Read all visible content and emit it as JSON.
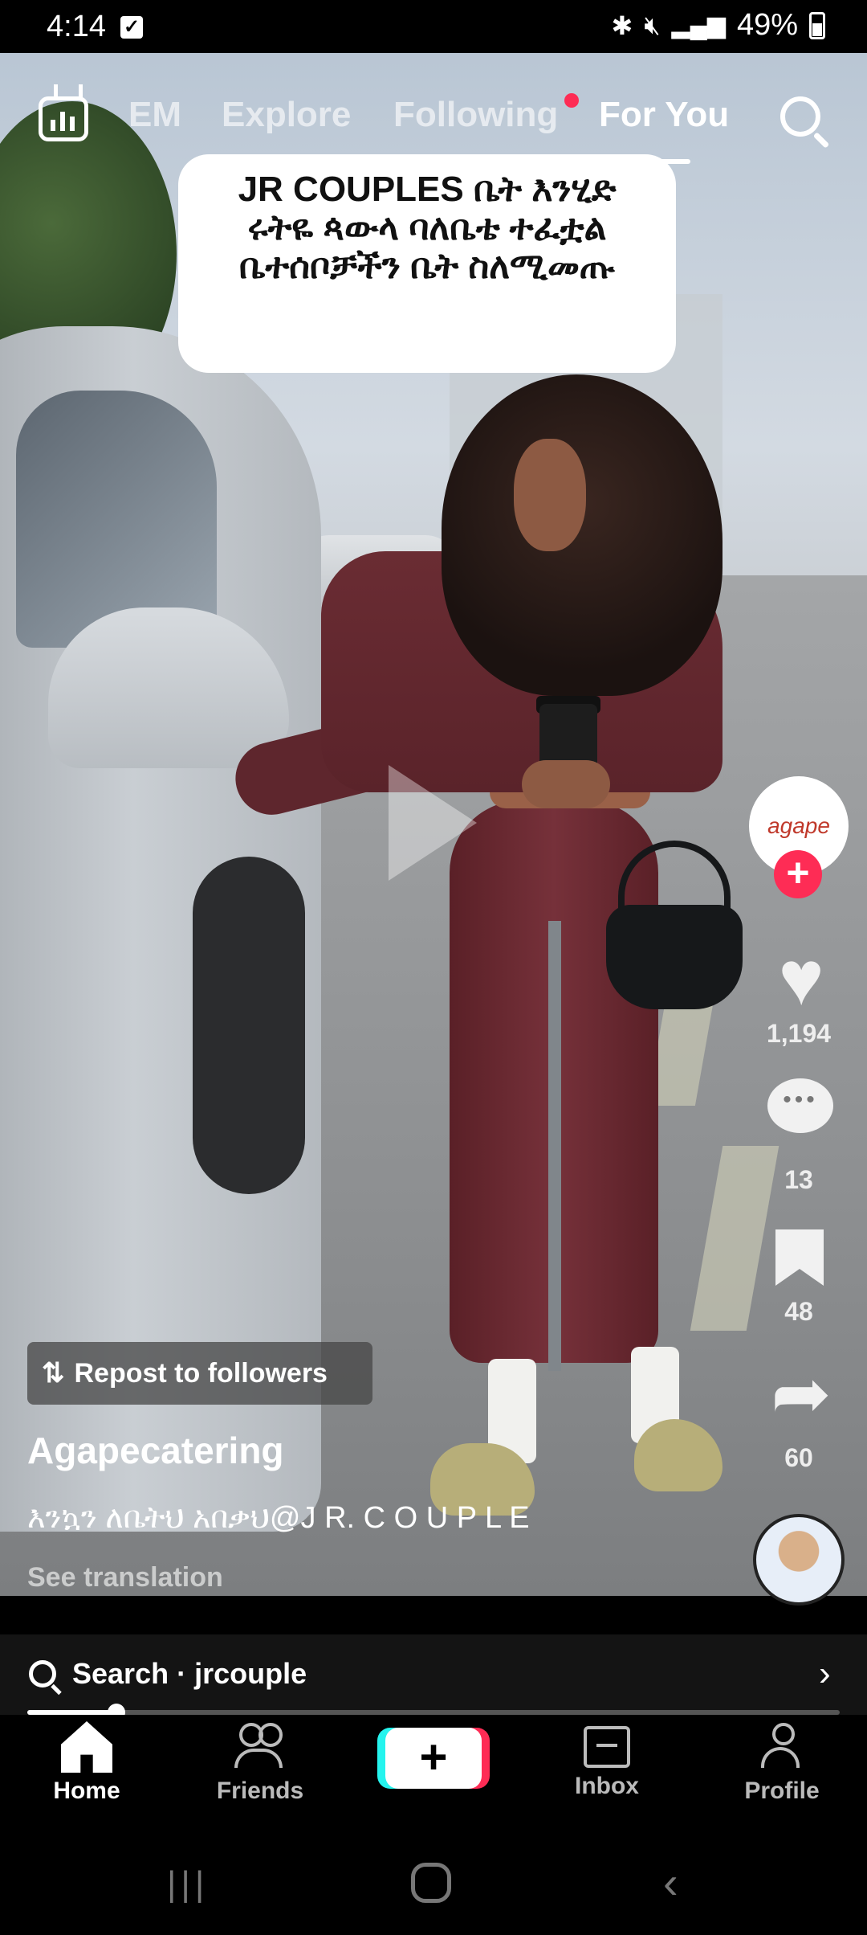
{
  "status_bar": {
    "time": "4:14",
    "battery": "49%"
  },
  "top_tabs": {
    "items": [
      "EM",
      "Explore",
      "Following",
      "For You"
    ],
    "active": "For You"
  },
  "caption_card": {
    "lines": [
      "JR COUPLES ቤት እንሂድ",
      "ሩትዬ ጳውላ ባለቤቴ ተፈቷል",
      "ቤተሰቦቻችን ቤት ስለሚመጡ"
    ]
  },
  "actions": {
    "creator_logo_text": "agape",
    "follow_label": "+",
    "likes": "1,194",
    "comments": "13",
    "saves": "48",
    "shares": "60"
  },
  "post": {
    "repost_label": "Repost to followers",
    "username": "Agapecatering",
    "description": "እንኳን ለቤትህ አበቃህ@J R. C O U P L E",
    "see_translation": "See translation"
  },
  "search_bar": {
    "text": "Search · jrcouple"
  },
  "playback_progress": 0.11,
  "bottom_nav": {
    "home": "Home",
    "friends": "Friends",
    "create": "+",
    "inbox": "Inbox",
    "profile": "Profile"
  },
  "colors": {
    "accent_red": "#fe2c55",
    "accent_cyan": "#25f4ee"
  },
  "icons": [
    "live-tv-icon",
    "search-icon",
    "play-icon",
    "heart-icon",
    "comment-icon",
    "bookmark-icon",
    "share-icon",
    "repost-icon",
    "home-icon",
    "friends-icon",
    "inbox-icon",
    "profile-icon",
    "chevron-right-icon"
  ]
}
